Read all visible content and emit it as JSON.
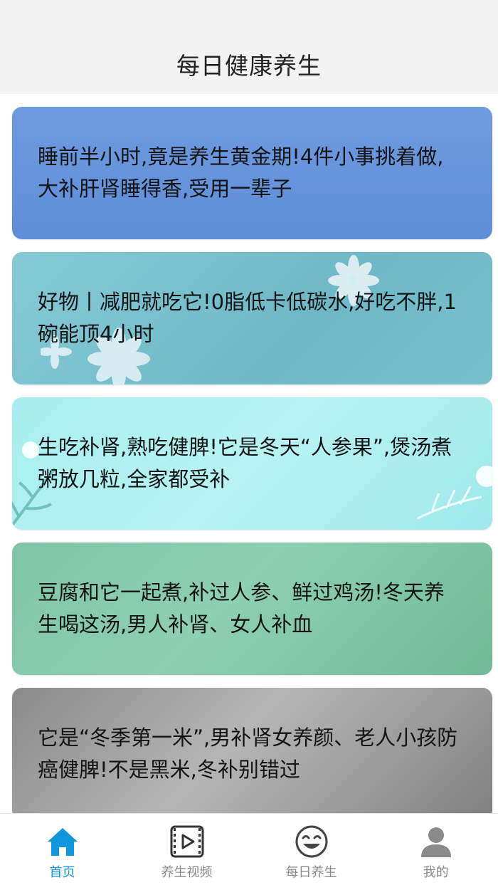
{
  "header": {
    "title": "每日健康养生"
  },
  "articles": [
    {
      "title": "睡前半小时,竟是养生黄金期!4件小事挑着做,大补肝肾睡得香,受用一辈子"
    },
    {
      "title": "好物丨减肥就吃它!0脂低卡低碳水,好吃不胖,1碗能顶4小时"
    },
    {
      "title": "生吃补肾,熟吃健脾!它是冬天“人参果”,煲汤煮粥放几粒,全家都受补"
    },
    {
      "title": "豆腐和它一起煮,补过人参、鲜过鸡汤!冬天养生喝这汤,男人补肾、女人补血"
    },
    {
      "title": "它是“冬季第一米”,男补肾女养颜、老人小孩防癌健脾!不是黑米,冬补别错过"
    }
  ],
  "tabbar": {
    "active_color": "#1296db",
    "inactive_color": "#8a8a8a",
    "tabs": [
      {
        "label": "首页",
        "icon": "home-icon",
        "active": true
      },
      {
        "label": "养生视频",
        "icon": "video-icon",
        "active": false
      },
      {
        "label": "每日养生",
        "icon": "smiley-icon",
        "active": false
      },
      {
        "label": "我的",
        "icon": "user-icon",
        "active": false
      }
    ]
  }
}
